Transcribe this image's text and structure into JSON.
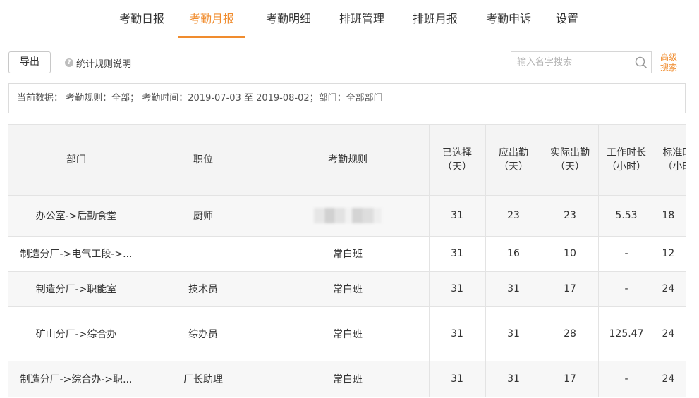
{
  "nav": {
    "tabs": [
      {
        "label": "考勤日报",
        "active": false
      },
      {
        "label": "考勤月报",
        "active": true
      },
      {
        "label": "考勤明细",
        "active": false
      },
      {
        "label": "排班管理",
        "active": false
      },
      {
        "label": "排班月报",
        "active": false
      },
      {
        "label": "考勤申诉",
        "active": false
      },
      {
        "label": "设置",
        "active": false
      }
    ],
    "accent_color": "#f08c2e"
  },
  "toolbar": {
    "export_label": "导出",
    "rules_label": "统计规则说明",
    "search_placeholder": "输入名字搜索",
    "advanced_search_label": "高级搜索"
  },
  "filter": {
    "text": "当前数据： 考勤规则：全部； 考勤时间：2019-07-03 至 2019-08-02；部门：全部部门"
  },
  "table": {
    "headers": [
      {
        "line1": "部门",
        "line2": ""
      },
      {
        "line1": "职位",
        "line2": ""
      },
      {
        "line1": "考勤规则",
        "line2": ""
      },
      {
        "line1": "已选择",
        "line2": "（天）"
      },
      {
        "line1": "应出勤",
        "line2": "（天）"
      },
      {
        "line1": "实际出勤",
        "line2": "（天）"
      },
      {
        "line1": "工作时长",
        "line2": "（小时）"
      },
      {
        "line1": "标准时",
        "line2": "（小时）"
      }
    ],
    "rows": [
      {
        "dept": "办公室->后勤食堂",
        "position": "厨师",
        "rule": "",
        "rule_blurred": true,
        "selected": "31",
        "required": "23",
        "actual": "23",
        "hours": "5.53",
        "std": "18"
      },
      {
        "dept": "制造分厂->电气工段->...",
        "position": "",
        "rule": "常白班",
        "rule_blurred": false,
        "selected": "31",
        "required": "16",
        "actual": "10",
        "hours": "-",
        "std": "12"
      },
      {
        "dept": "制造分厂->职能室",
        "position": "技术员",
        "rule": "常白班",
        "rule_blurred": false,
        "selected": "31",
        "required": "31",
        "actual": "17",
        "hours": "-",
        "std": "24"
      },
      {
        "dept": "矿山分厂->综合办",
        "position": "综办员",
        "rule": "常白班",
        "rule_blurred": false,
        "selected": "31",
        "required": "31",
        "actual": "28",
        "hours": "125.47",
        "std": "24"
      },
      {
        "dept": "制造分厂->综合办->职...",
        "position": "厂长助理",
        "rule": "常白班",
        "rule_blurred": false,
        "selected": "31",
        "required": "31",
        "actual": "17",
        "hours": "-",
        "std": "24"
      }
    ]
  }
}
